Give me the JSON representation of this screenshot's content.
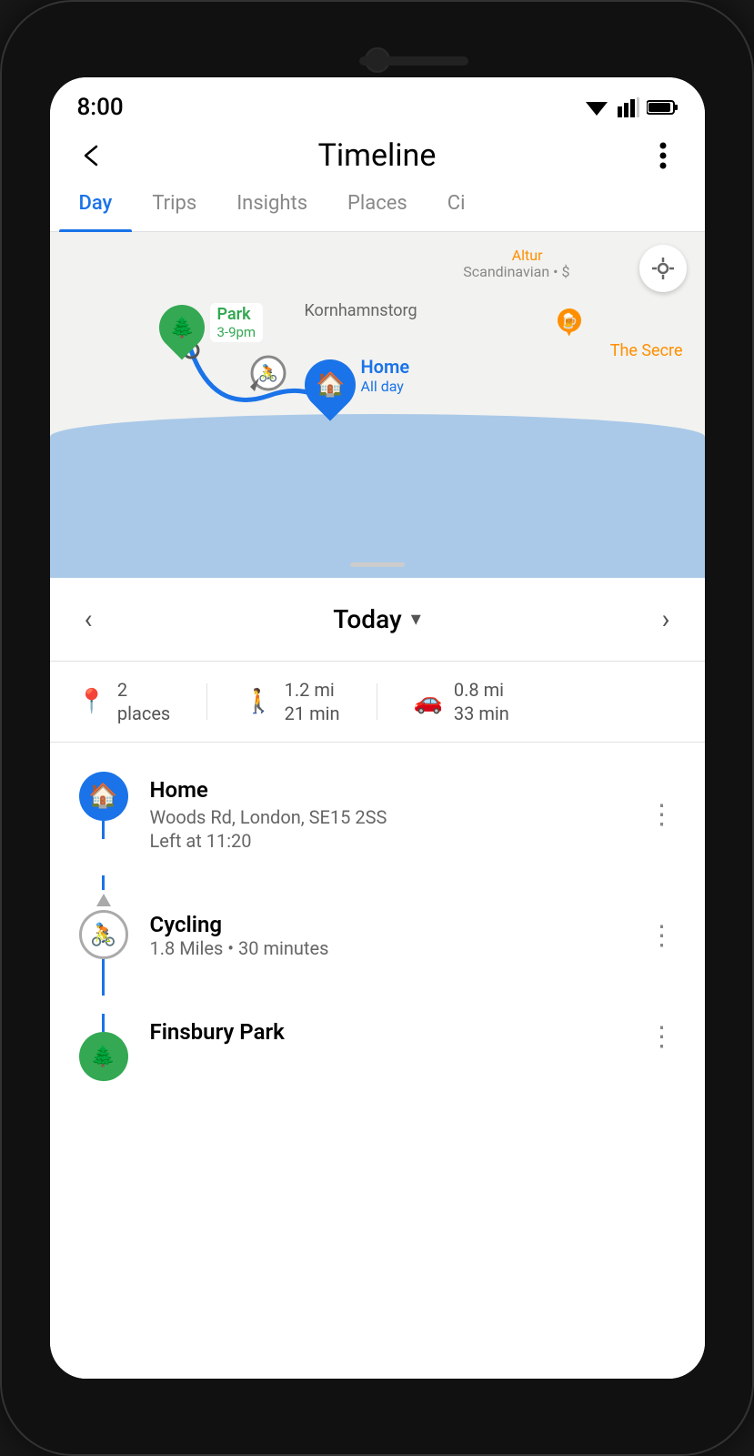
{
  "phone": {
    "time": "8:00",
    "title": "Timeline"
  },
  "tabs": [
    {
      "id": "day",
      "label": "Day",
      "active": true
    },
    {
      "id": "trips",
      "label": "Trips",
      "active": false
    },
    {
      "id": "insights",
      "label": "Insights",
      "active": false
    },
    {
      "id": "places",
      "label": "Places",
      "active": false
    },
    {
      "id": "cities",
      "label": "Ci",
      "active": false
    }
  ],
  "map": {
    "insights_bubble": "Scandinavian • $",
    "altur_label": "Altur",
    "kornhamnstorg": "Kornhamnstorg",
    "secret_label": "The Secre",
    "park_name": "Park",
    "park_time": "3-9pm",
    "home_name": "Home",
    "home_time": "All day"
  },
  "date_nav": {
    "prev_label": "‹",
    "next_label": "›",
    "label": "Today",
    "chevron": "▾"
  },
  "stats": {
    "places_count": "2",
    "places_label": "places",
    "walk_dist": "1.2 mi",
    "walk_time": "21 min",
    "drive_dist": "0.8 mi",
    "drive_time": "33 min"
  },
  "timeline": {
    "home": {
      "name": "Home",
      "address": "Woods Rd, London, SE15 2SS",
      "time": "Left at 11:20"
    },
    "cycling": {
      "name": "Cycling",
      "detail": "1.8 Miles • 30 minutes"
    },
    "finsbury": {
      "name": "Finsbury Park"
    }
  },
  "buttons": {
    "back": "←",
    "menu": "⋮",
    "location": "◎"
  }
}
